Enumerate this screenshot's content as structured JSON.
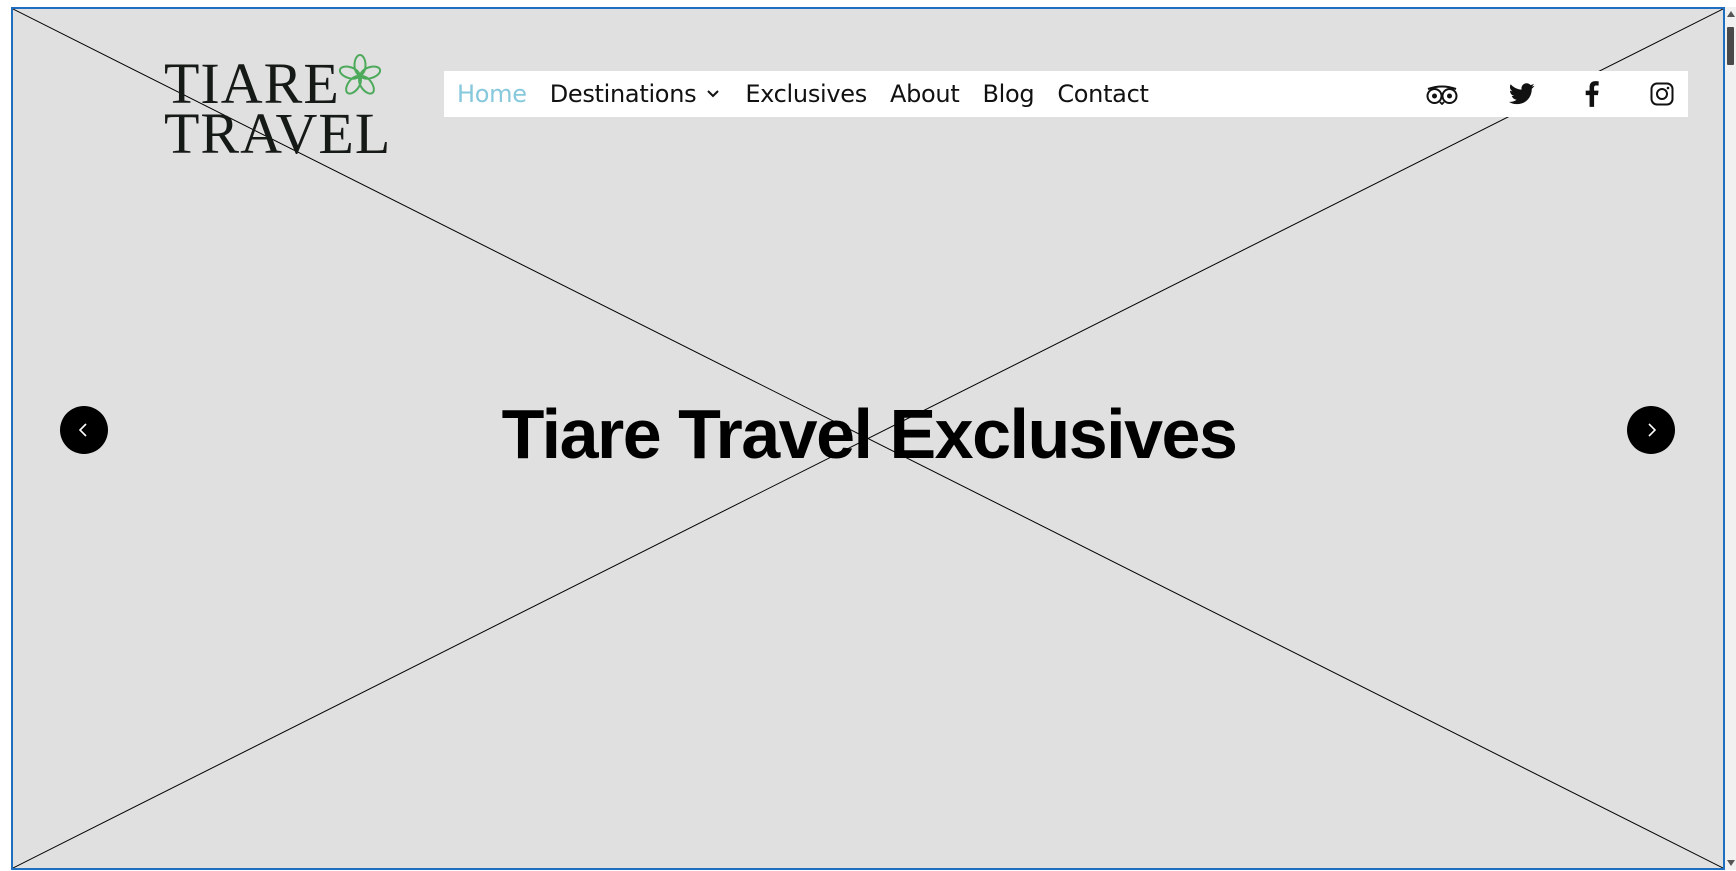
{
  "logo": {
    "line1": "TIARE",
    "line2": "TRAVEL",
    "flower_color": "#4caa5a"
  },
  "nav": {
    "items": [
      {
        "label": "Home",
        "active": true
      },
      {
        "label": "Destinations",
        "has_dropdown": true
      },
      {
        "label": "Exclusives"
      },
      {
        "label": "About"
      },
      {
        "label": "Blog"
      },
      {
        "label": "Contact"
      }
    ],
    "active_color": "#86c8dc"
  },
  "socials": {
    "icons": [
      "tripadvisor-icon",
      "twitter-icon",
      "facebook-icon",
      "instagram-icon"
    ]
  },
  "hero": {
    "title": "Tiare Travel Exclusives",
    "background": "#e0e0e0"
  },
  "carousel": {
    "prev_icon": "chevron-left-icon",
    "next_icon": "chevron-right-icon"
  },
  "frame": {
    "border_color": "#1f6fc0"
  }
}
